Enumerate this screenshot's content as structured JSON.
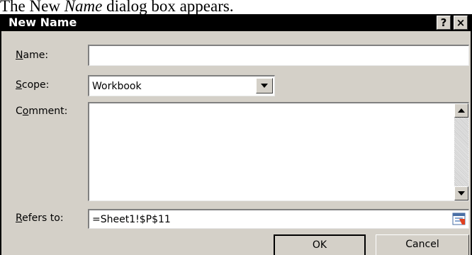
{
  "caption": {
    "prefix": "The New ",
    "emphasis": "Name",
    "suffix": " dialog box appears."
  },
  "dialog": {
    "title": "New Name",
    "help_button": "?",
    "close_button": "×"
  },
  "fields": {
    "name": {
      "label_access": "N",
      "label_rest": "ame:",
      "value": ""
    },
    "scope": {
      "label_access": "S",
      "label_rest": "cope:",
      "value": "Workbook"
    },
    "comment": {
      "label_pre": "C",
      "label_access": "o",
      "label_rest": "mment:",
      "value": ""
    },
    "refers_to": {
      "label_access": "R",
      "label_rest": "efers to:",
      "value": "=Sheet1!$P$11"
    }
  },
  "buttons": {
    "ok": "OK",
    "cancel": "Cancel"
  },
  "icons": {
    "dropdown": "triangle-down-icon",
    "scroll_up": "triangle-up-icon",
    "scroll_down": "triangle-down-icon",
    "collapse": "collapse-dialog-icon"
  },
  "colors": {
    "title_bar": "#000000",
    "dialog_face": "#d4d0c8",
    "field_bg": "#ffffff"
  }
}
